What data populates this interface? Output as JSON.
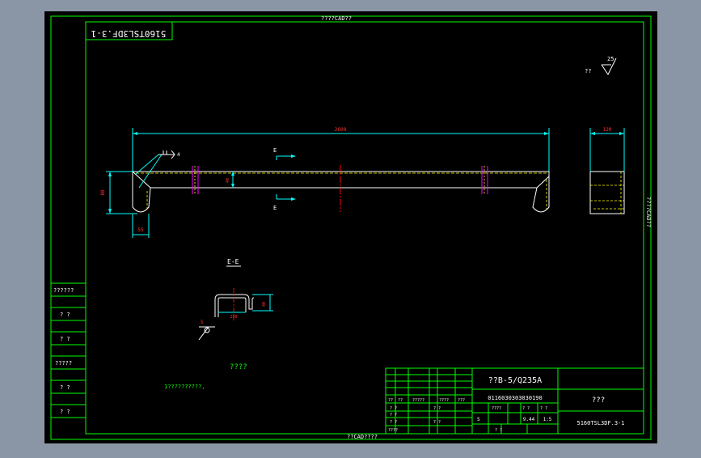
{
  "colors": {
    "frame": "#00ff00",
    "outline": "#ffffff",
    "dimension": "#00ffff",
    "centerline": "#ff0000",
    "hatch": "#ff00ff",
    "hidden": "#ffff00",
    "text_dim": "#ff3333",
    "sheet": "#000000",
    "window": "#8a96a6"
  },
  "sheet": {
    "top_label": "????CAD??",
    "bottom_label": "??CAD????",
    "right_label": "????CAD??",
    "drawing_number_flipped": "5160TSL3DF.3-1"
  },
  "main_view": {
    "dims": {
      "length": "2600",
      "height": "80",
      "bend": "55",
      "inner": "40",
      "side_width": "120"
    },
    "section_marker": "E",
    "weld_symbol_number": "4"
  },
  "roughness": {
    "prefix": "??",
    "value": "25"
  },
  "section_view": {
    "title": "E-E",
    "dims": {
      "thickness": "5",
      "width": "200",
      "height": "40"
    }
  },
  "notes": {
    "heading": "????",
    "line1": "1??????????,"
  },
  "left_strip": {
    "labels": [
      "??????",
      "? ?",
      "? ?",
      "?????",
      "? ?",
      "? ?"
    ]
  },
  "title_block": {
    "material": "??B-5/Q235A",
    "code": "0116030303030190",
    "name": "???",
    "drawing_number": "5160TSL3DF.3-1",
    "stage": "S",
    "weight": "9.44",
    "scale": "1:5",
    "row_labels": [
      "? ?",
      "? ?",
      "? ?",
      "????"
    ],
    "header_labels": [
      "??",
      "??",
      "?????",
      "????",
      "???"
    ],
    "mid_labels": [
      "????",
      "? ?",
      "? ?"
    ],
    "page_labels": [
      "? ?",
      "? ?",
      "? ?"
    ]
  }
}
